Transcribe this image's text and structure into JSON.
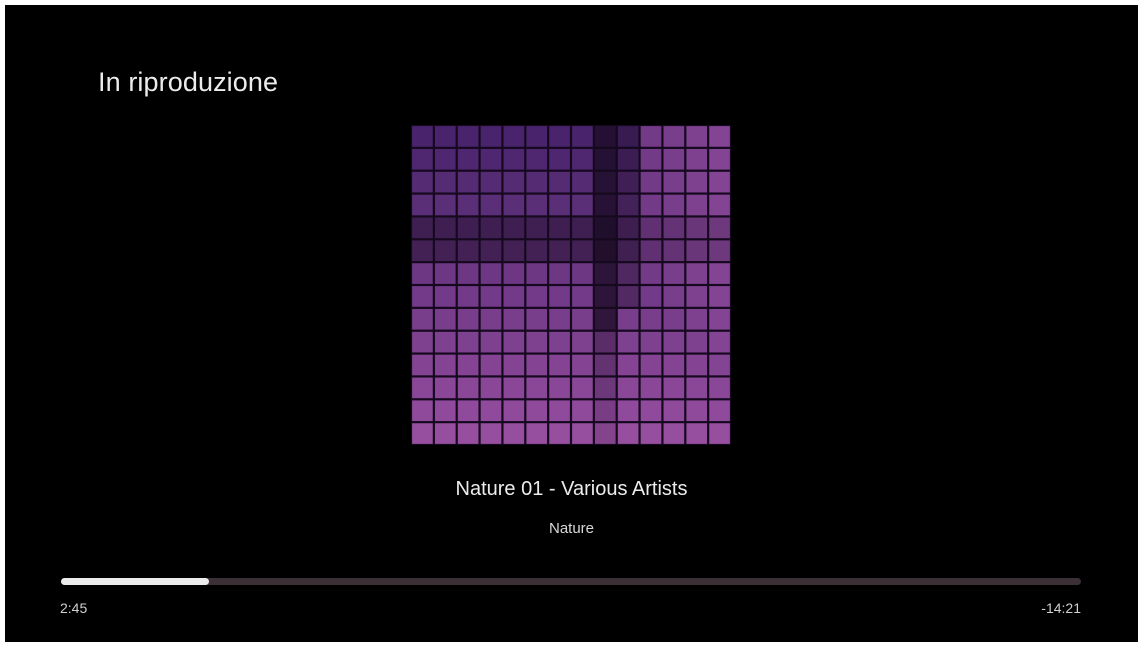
{
  "header": {
    "title": "In riproduzione"
  },
  "now_playing": {
    "track_title": "Nature 01 - Various Artists",
    "album": "Nature",
    "artwork_icon": "album-artwork-purple-grid",
    "artwork_colors": {
      "light": "#a053a6",
      "dark": "#3a1c62",
      "shadow": "#16091f"
    }
  },
  "playback": {
    "elapsed": "2:45",
    "remaining": "-14:21",
    "progress": 0.145
  }
}
